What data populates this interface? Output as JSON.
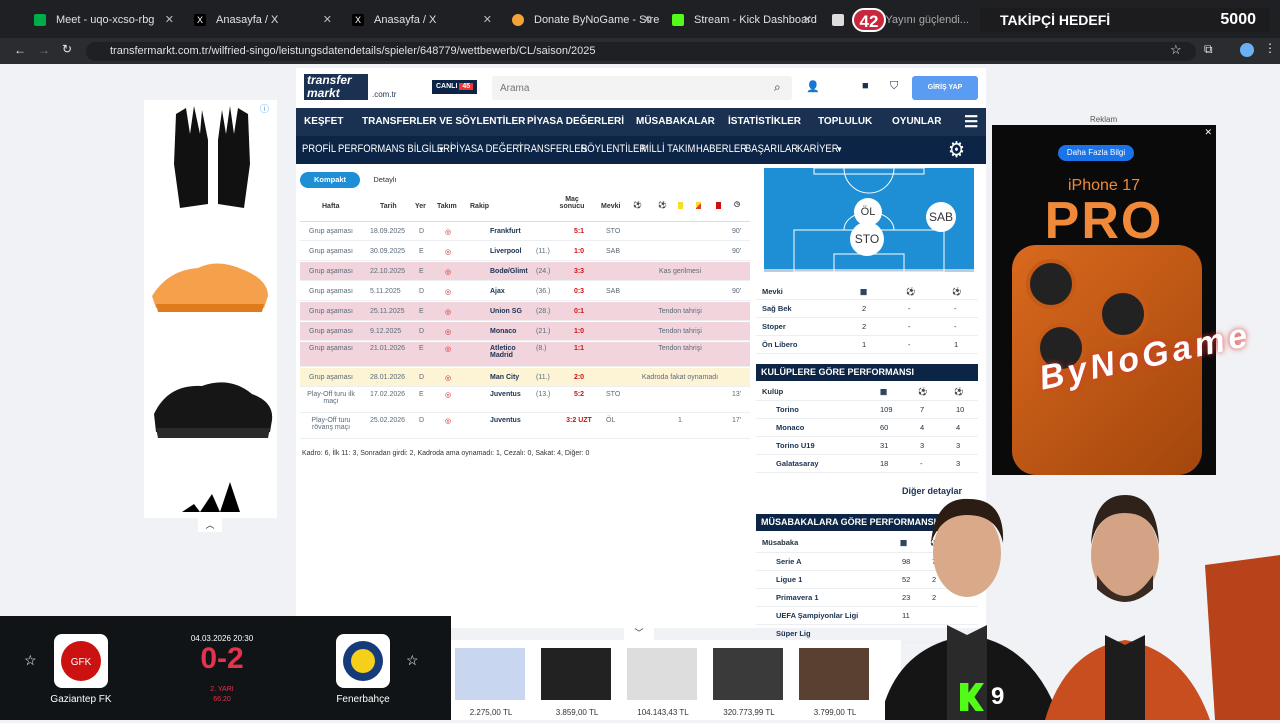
{
  "browser": {
    "tabs": [
      {
        "title": "Meet - uqo-xcso-rbg",
        "color": "#00ac47"
      },
      {
        "title": "Anasayfa / X",
        "color": "#ffffff"
      },
      {
        "title": "Anasayfa / X",
        "color": "#ffffff"
      },
      {
        "title": "Donate ByNoGame - Streamer",
        "color": "#f2a33a"
      },
      {
        "title": "Stream - Kick Dashboard",
        "color": "#53fc18"
      },
      {
        "title": "S...u | Yayını güçlendi...",
        "color": "#dddddd"
      }
    ],
    "url": "transfermarkt.com.tr/wilfried-singo/leistungsdatendetails/spieler/648779/wettbewerb/CL/saison/2025",
    "overlay_counter": "42",
    "goal_label": "TAKİPÇİ HEDEFİ",
    "goal_value": "5000"
  },
  "tm": {
    "logo": "transfer markt",
    "domain": ".com.tr",
    "live": "CANLI",
    "live_count": "45",
    "search_placeholder": "Arama",
    "login": "GİRİŞ YAP",
    "nav1": [
      "KEŞFET",
      "TRANSFERLER VE SÖYLENTİLER",
      "PİYASA DEĞERLERİ",
      "MÜSABAKALAR",
      "İSTATİSTİKLER",
      "TOPLULUK",
      "OYUNLAR"
    ],
    "nav2": [
      "PROFİL",
      "PERFORMANS BİLGİLERİ",
      "PİYASA DEĞERİ",
      "TRANSFERLER",
      "SÖYLENTİLER",
      "MİLLİ TAKIM",
      "HABERLER",
      "BAŞARILAR",
      "KARİYER"
    ],
    "tabs": [
      "Kompakt",
      "Detaylı"
    ],
    "cols": [
      "Hafta",
      "Tarih",
      "Yer",
      "Takım",
      "Rakip",
      "Maç sonucu",
      "Mevki"
    ],
    "rows": [
      {
        "w": "Grup aşaması",
        "d": "18.09.2025",
        "y": "D",
        "r": "Frankfurt",
        "rk": "",
        "s": "5:1",
        "m": "STO",
        "x": "",
        "t": "90'",
        "k": ""
      },
      {
        "w": "Grup aşaması",
        "d": "30.09.2025",
        "y": "E",
        "r": "Liverpool",
        "rk": "(11.)",
        "s": "1:0",
        "m": "SAB",
        "x": "",
        "t": "90'",
        "k": ""
      },
      {
        "w": "Grup aşaması",
        "d": "22.10.2025",
        "y": "E",
        "r": "Bodø/Glimt",
        "rk": "(24.)",
        "s": "3:3",
        "m": "",
        "x": "Kas gerilmesi",
        "t": "",
        "k": "red"
      },
      {
        "w": "Grup aşaması",
        "d": "5.11.2025",
        "y": "D",
        "r": "Ajax",
        "rk": "(36.)",
        "s": "0:3",
        "m": "SAB",
        "x": "",
        "t": "90'",
        "k": ""
      },
      {
        "w": "Grup aşaması",
        "d": "25.11.2025",
        "y": "E",
        "r": "Union SG",
        "rk": "(28.)",
        "s": "0:1",
        "m": "",
        "x": "Tendon tahrişi",
        "t": "",
        "k": "red"
      },
      {
        "w": "Grup aşaması",
        "d": "9.12.2025",
        "y": "D",
        "r": "Monaco",
        "rk": "(21.)",
        "s": "1:0",
        "m": "",
        "x": "Tendon tahrişi",
        "t": "",
        "k": "red"
      },
      {
        "w": "Grup aşaması",
        "d": "21.01.2026",
        "y": "E",
        "r": "Atletico Madrid",
        "rk": "(8.)",
        "s": "1:1",
        "m": "",
        "x": "Tendon tahrişi",
        "t": "",
        "k": "red"
      },
      {
        "w": "Grup aşaması",
        "d": "28.01.2026",
        "y": "D",
        "r": "Man City",
        "rk": "(11.)",
        "s": "2:0",
        "m": "",
        "x": "Kadroda fakat oynamadı",
        "t": "",
        "k": "yel"
      },
      {
        "w": "Play-Off turu ilk maçı",
        "d": "17.02.2026",
        "y": "E",
        "r": "Juventus",
        "rk": "(13.)",
        "s": "5:2",
        "m": "STO",
        "x": "",
        "t": "13'",
        "k": ""
      },
      {
        "w": "Play-Off turu rövanş maçı",
        "d": "25.02.2026",
        "y": "D",
        "r": "Juventus",
        "rk": "",
        "s": "3:2 UZT",
        "m": "ÖL",
        "x": "1",
        "t": "17'",
        "k": ""
      }
    ],
    "summary": "Kadro: 6, İlk 11: 3, Sonradan girdi: 2, Kadroda ama oynamadı: 1, Cezalı: 0, Sakat: 4, Diğer: 0",
    "pitch": [
      "ÖL",
      "SAB",
      "STO"
    ],
    "pos_head": "Mevki",
    "positions": [
      {
        "n": "Sağ Bek",
        "a": "2",
        "b": "-",
        "c": "-"
      },
      {
        "n": "Stoper",
        "a": "2",
        "b": "-",
        "c": "-"
      },
      {
        "n": "Ön Libero",
        "a": "1",
        "b": "-",
        "c": "1"
      }
    ],
    "club_title": "KULÜPLERE GÖRE PERFORMANSI",
    "club_head": "Kulüp",
    "clubs": [
      {
        "n": "Torino",
        "a": "109",
        "b": "7",
        "c": "10"
      },
      {
        "n": "Monaco",
        "a": "60",
        "b": "4",
        "c": "4"
      },
      {
        "n": "Torino U19",
        "a": "31",
        "b": "3",
        "c": "3"
      },
      {
        "n": "Galatasaray",
        "a": "18",
        "b": "-",
        "c": "3"
      }
    ],
    "more": "Diğer detaylar",
    "comp_title": "MÜSABAKALARA GÖRE PERFORMANSI",
    "comp_head": "Müsabaka",
    "comps": [
      {
        "n": "Serie A",
        "a": "98",
        "b": "7"
      },
      {
        "n": "Ligue 1",
        "a": "52",
        "b": "2"
      },
      {
        "n": "Primavera 1",
        "a": "23",
        "b": "2"
      },
      {
        "n": "UEFA Şampiyonlar Ligi",
        "a": "11",
        "b": ""
      },
      {
        "n": "Süper Lig",
        "a": "",
        "b": ""
      }
    ]
  },
  "ad": {
    "label": "Reklam",
    "button": "Daha Fazla Bilgi",
    "brand": "iPhone 17",
    "model": "PRO",
    "streamer": "ByNoGame"
  },
  "score": {
    "home": "Gaziantep FK",
    "away": "Fenerbahçe",
    "date": "04.03.2026 20:30",
    "result": "0-2",
    "half": "2. YARI",
    "time": "66:20"
  },
  "shop": [
    "2.275,00 TL",
    "3.859,00 TL",
    "104.143,43 TL",
    "320.773,99 TL",
    "3.799,00 TL"
  ],
  "kick": "9"
}
